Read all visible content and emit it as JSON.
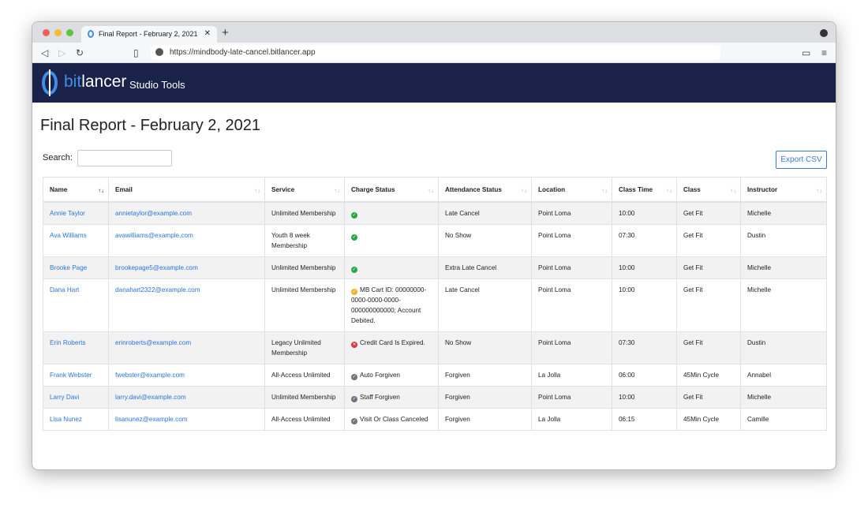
{
  "browser": {
    "tab_title": "Final Report - February 2, 2021",
    "url": "https://mindbody-late-cancel.bitlancer.app"
  },
  "nav": {
    "brand_prefix": "bit",
    "brand_suffix": "lancer",
    "app_name": "Studio Tools"
  },
  "page": {
    "title": "Final Report - February 2, 2021",
    "search_label": "Search:",
    "search_value": "",
    "export_label": "Export CSV"
  },
  "colors": {
    "nav": "#1a2249",
    "accent": "#3f8fe6",
    "ok": "#28a745",
    "warn": "#f0b429",
    "error": "#dc3545",
    "neutral": "#6c757d"
  },
  "table": {
    "columns": [
      "Name",
      "Email",
      "Service",
      "Charge Status",
      "Attendance Status",
      "Location",
      "Class Time",
      "Class",
      "Instructor"
    ],
    "rows": [
      {
        "name": "Annie Taylor",
        "email": "annietaylor@example.com",
        "service": "Unlimited Membership",
        "charge_icon": "check-ok",
        "charge": "",
        "attendance": "Late Cancel",
        "location": "Point Loma",
        "time": "10:00",
        "class": "Get Fit",
        "instructor": "Michelle"
      },
      {
        "name": "Ava Williams",
        "email": "avawilliams@example.com",
        "service": "Youth 8 week Membership",
        "charge_icon": "check-ok",
        "charge": "",
        "attendance": "No Show",
        "location": "Point Loma",
        "time": "07:30",
        "class": "Get Fit",
        "instructor": "Dustin"
      },
      {
        "name": "Brooke Page",
        "email": "brookepage5@example.com",
        "service": "Unlimited Membership",
        "charge_icon": "check-ok",
        "charge": "",
        "attendance": "Extra Late Cancel",
        "location": "Point Loma",
        "time": "10:00",
        "class": "Get Fit",
        "instructor": "Michelle"
      },
      {
        "name": "Dana Hart",
        "email": "danahart2322@example.com",
        "service": "Unlimited Membership",
        "charge_icon": "check-warn",
        "charge": "MB Cart ID: 00000000-0000-0000-0000-000000000000; Account Debited.",
        "attendance": "Late Cancel",
        "location": "Point Loma",
        "time": "10:00",
        "class": "Get Fit",
        "instructor": "Michelle"
      },
      {
        "name": "Erin Roberts",
        "email": "erinroberts@example.com",
        "service": "Legacy Unlimited Membership",
        "charge_icon": "error",
        "charge": "Credit Card Is Expired.",
        "attendance": "No Show",
        "location": "Point Loma",
        "time": "07:30",
        "class": "Get Fit",
        "instructor": "Dustin"
      },
      {
        "name": "Frank Webster",
        "email": "fwebster@example.com",
        "service": "All-Access Unlimited",
        "charge_icon": "check-neutral",
        "charge": "Auto Forgiven",
        "attendance": "Forgiven",
        "location": "La Jolla",
        "time": "06:00",
        "class": "45Min Cycle",
        "instructor": "Annabel"
      },
      {
        "name": "Larry Davi",
        "email": "larry.davi@example.com",
        "service": "Unlimited Membership",
        "charge_icon": "check-neutral",
        "charge": "Staff Forgiven",
        "attendance": "Forgiven",
        "location": "Point Loma",
        "time": "10:00",
        "class": "Get Fit",
        "instructor": "Michelle"
      },
      {
        "name": "Lisa Nunez",
        "email": "lisanunez@example.com",
        "service": "All-Access Unlimited",
        "charge_icon": "check-neutral",
        "charge": "Visit Or Class Canceled",
        "attendance": "Forgiven",
        "location": "La Jolla",
        "time": "06:15",
        "class": "45Min Cycle",
        "instructor": "Camille"
      }
    ]
  }
}
